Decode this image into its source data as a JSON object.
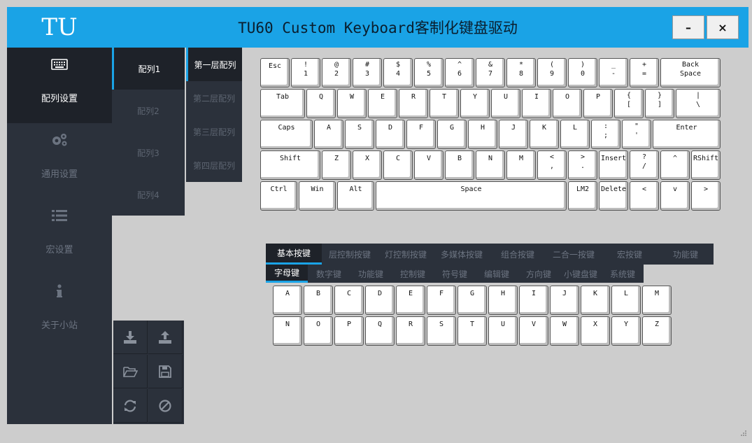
{
  "app": {
    "logo": "TU",
    "title": "TU60 Custom Keyboard客制化键盘驱动",
    "minimize_label": "–",
    "close_label": "×"
  },
  "sidebar": {
    "items": [
      {
        "label": "配列设置",
        "icon": "keyboard-icon",
        "active": true
      },
      {
        "label": "通用设置",
        "icon": "gears-icon",
        "active": false
      },
      {
        "label": "宏设置",
        "icon": "list-icon",
        "active": false
      },
      {
        "label": "关于小站",
        "icon": "info-icon",
        "active": false
      }
    ]
  },
  "profiles": [
    "配列1",
    "配列2",
    "配列3",
    "配列4"
  ],
  "layers": [
    "第一层配列",
    "第二层配列",
    "第三层配列",
    "第四层配列"
  ],
  "tools": [
    {
      "icon": "download-icon"
    },
    {
      "icon": "upload-icon"
    },
    {
      "icon": "folder-open-icon"
    },
    {
      "icon": "save-icon"
    },
    {
      "icon": "refresh-icon"
    },
    {
      "icon": "ban-icon"
    }
  ],
  "keyboard": {
    "rows": [
      [
        {
          "t": "Esc",
          "w": 42
        },
        {
          "t": "!",
          "b": "1",
          "w": 42
        },
        {
          "t": "@",
          "b": "2",
          "w": 42
        },
        {
          "t": "#",
          "b": "3",
          "w": 42
        },
        {
          "t": "$",
          "b": "4",
          "w": 42
        },
        {
          "t": "%",
          "b": "5",
          "w": 42
        },
        {
          "t": "^",
          "b": "6",
          "w": 42
        },
        {
          "t": "&",
          "b": "7",
          "w": 42
        },
        {
          "t": "*",
          "b": "8",
          "w": 42
        },
        {
          "t": "(",
          "b": "9",
          "w": 42
        },
        {
          "t": ")",
          "b": "0",
          "w": 42
        },
        {
          "t": "_",
          "b": "-",
          "w": 42
        },
        {
          "t": "+",
          "b": "=",
          "w": 42
        },
        {
          "t": "Back",
          "b": "Space",
          "w": 86
        }
      ],
      [
        {
          "t": "Tab",
          "w": 64
        },
        {
          "t": "Q",
          "w": 42
        },
        {
          "t": "W",
          "w": 42
        },
        {
          "t": "E",
          "w": 42
        },
        {
          "t": "R",
          "w": 42
        },
        {
          "t": "T",
          "w": 42
        },
        {
          "t": "Y",
          "w": 42
        },
        {
          "t": "U",
          "w": 42
        },
        {
          "t": "I",
          "w": 42
        },
        {
          "t": "O",
          "w": 42
        },
        {
          "t": "P",
          "w": 42
        },
        {
          "t": "{",
          "b": "[",
          "w": 42
        },
        {
          "t": "}",
          "b": "]",
          "w": 42
        },
        {
          "t": "|",
          "b": "\\",
          "w": 64
        }
      ],
      [
        {
          "t": "Caps",
          "w": 75
        },
        {
          "t": "A",
          "w": 42
        },
        {
          "t": "S",
          "w": 42
        },
        {
          "t": "D",
          "w": 42
        },
        {
          "t": "F",
          "w": 42
        },
        {
          "t": "G",
          "w": 42
        },
        {
          "t": "H",
          "w": 42
        },
        {
          "t": "J",
          "w": 42
        },
        {
          "t": "K",
          "w": 42
        },
        {
          "t": "L",
          "w": 42
        },
        {
          "t": ":",
          "b": ";",
          "w": 42
        },
        {
          "t": "\"",
          "b": "'",
          "w": 42
        },
        {
          "t": "Enter",
          "w": 97
        }
      ],
      [
        {
          "t": "Shift",
          "w": 86
        },
        {
          "t": "Z",
          "w": 42
        },
        {
          "t": "X",
          "w": 42
        },
        {
          "t": "C",
          "w": 42
        },
        {
          "t": "V",
          "w": 42
        },
        {
          "t": "B",
          "w": 42
        },
        {
          "t": "N",
          "w": 42
        },
        {
          "t": "M",
          "w": 42
        },
        {
          "t": "<",
          "b": ",",
          "w": 42
        },
        {
          "t": ">",
          "b": ".",
          "w": 42
        },
        {
          "t": "Insert",
          "w": 42
        },
        {
          "t": "?",
          "b": "/",
          "w": 42
        },
        {
          "t": "^",
          "w": 42
        },
        {
          "t": "RShift",
          "w": 42
        }
      ],
      [
        {
          "t": "Ctrl",
          "w": 53
        },
        {
          "t": "Win",
          "w": 53
        },
        {
          "t": "Alt",
          "w": 53
        },
        {
          "t": "Space",
          "w": 273
        },
        {
          "t": "LM2",
          "w": 42
        },
        {
          "t": "Delete",
          "w": 42
        },
        {
          "t": "<",
          "w": 42
        },
        {
          "t": "v",
          "w": 42
        },
        {
          "t": ">",
          "w": 42
        }
      ]
    ]
  },
  "category_tabs": [
    "基本按键",
    "层控制按键",
    "灯控制按键",
    "多媒体按键",
    "组合按键",
    "二合一按键",
    "宏按键",
    "功能键"
  ],
  "sub_tabs": [
    "字母键",
    "数字键",
    "功能键",
    "控制键",
    "符号键",
    "编辑键",
    "方向键",
    "小键盘键",
    "系统键"
  ],
  "letter_keys": [
    [
      "A",
      "B",
      "C",
      "D",
      "E",
      "F",
      "G",
      "H",
      "I",
      "J",
      "K",
      "L",
      "M"
    ],
    [
      "N",
      "O",
      "P",
      "Q",
      "R",
      "S",
      "T",
      "U",
      "V",
      "W",
      "X",
      "Y",
      "Z"
    ]
  ],
  "colors": {
    "accent": "#1aa3e6",
    "sidebar": "#2b313b",
    "sidebar_active": "#1e2229",
    "background": "#cdcdcd"
  }
}
